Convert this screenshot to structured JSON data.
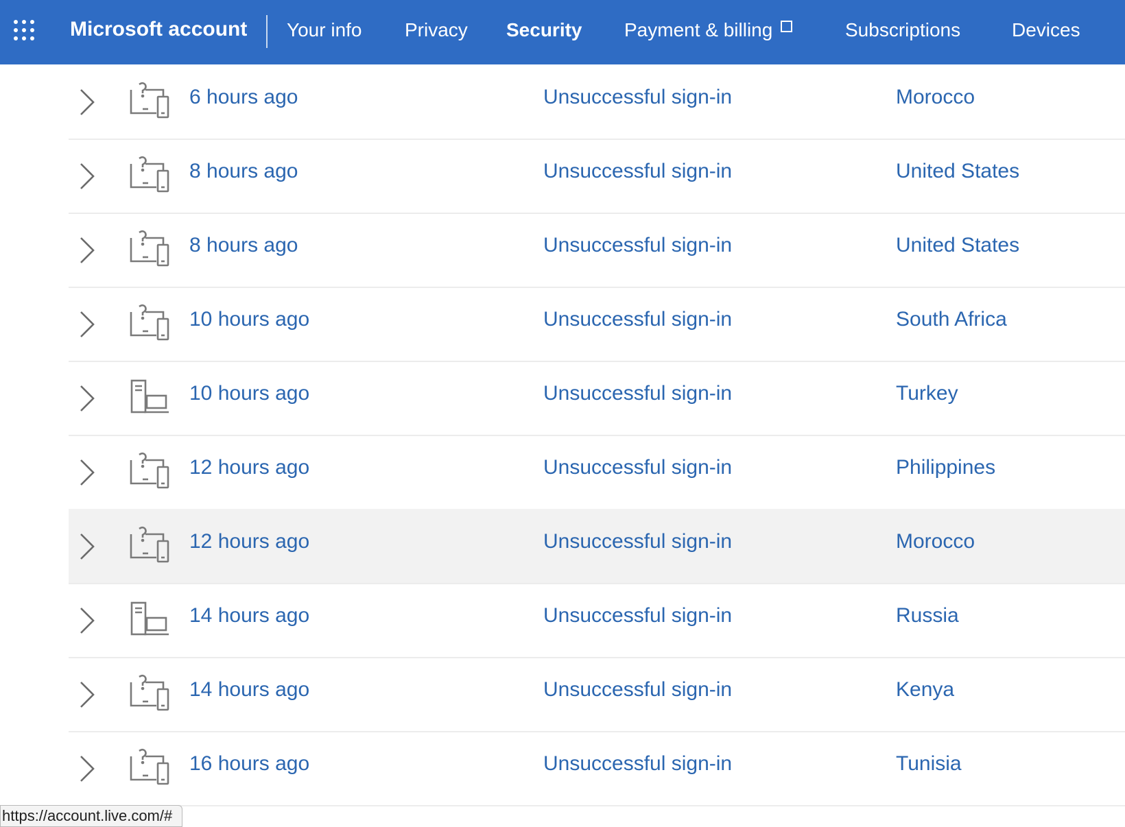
{
  "header": {
    "app_name": "Microsoft account",
    "bg_color": "#2f6cc4",
    "nav": [
      {
        "label": "Your info",
        "active": false,
        "external": false
      },
      {
        "label": "Privacy",
        "active": false,
        "external": false
      },
      {
        "label": "Security",
        "active": true,
        "external": false
      },
      {
        "label": "Payment & billing",
        "active": false,
        "external": true
      },
      {
        "label": "Subscriptions",
        "active": false,
        "external": false
      },
      {
        "label": "Devices",
        "active": false,
        "external": false
      }
    ]
  },
  "activity": {
    "text_color": "#2b66b0",
    "rows": [
      {
        "time": "6 hours ago",
        "event": "Unsuccessful sign-in",
        "location": "Morocco",
        "device_icon": "unknown-device-icon",
        "highlighted": false
      },
      {
        "time": "8 hours ago",
        "event": "Unsuccessful sign-in",
        "location": "United States",
        "device_icon": "unknown-device-icon",
        "highlighted": false
      },
      {
        "time": "8 hours ago",
        "event": "Unsuccessful sign-in",
        "location": "United States",
        "device_icon": "unknown-device-icon",
        "highlighted": false
      },
      {
        "time": "10 hours ago",
        "event": "Unsuccessful sign-in",
        "location": "South Africa",
        "device_icon": "unknown-device-icon",
        "highlighted": false
      },
      {
        "time": "10 hours ago",
        "event": "Unsuccessful sign-in",
        "location": "Turkey",
        "device_icon": "computer-device-icon",
        "highlighted": false
      },
      {
        "time": "12 hours ago",
        "event": "Unsuccessful sign-in",
        "location": "Philippines",
        "device_icon": "unknown-device-icon",
        "highlighted": false
      },
      {
        "time": "12 hours ago",
        "event": "Unsuccessful sign-in",
        "location": "Morocco",
        "device_icon": "unknown-device-icon",
        "highlighted": true
      },
      {
        "time": "14 hours ago",
        "event": "Unsuccessful sign-in",
        "location": "Russia",
        "device_icon": "computer-device-icon",
        "highlighted": false
      },
      {
        "time": "14 hours ago",
        "event": "Unsuccessful sign-in",
        "location": "Kenya",
        "device_icon": "unknown-device-icon",
        "highlighted": false
      },
      {
        "time": "16 hours ago",
        "event": "Unsuccessful sign-in",
        "location": "Tunisia",
        "device_icon": "unknown-device-icon",
        "highlighted": false
      }
    ]
  },
  "status_bar": {
    "url": "https://account.live.com/#"
  }
}
